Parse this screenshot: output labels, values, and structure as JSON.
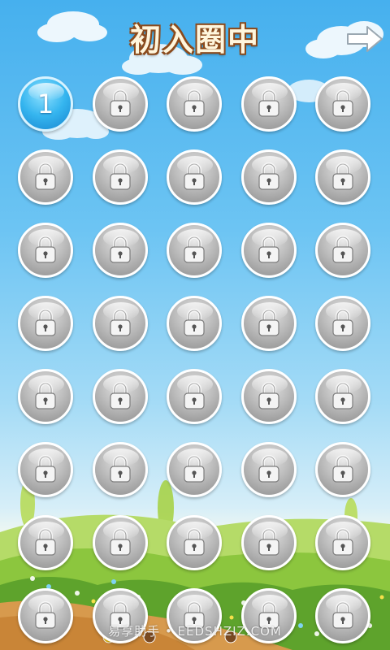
{
  "header": {
    "title": "初入圈中",
    "next_icon": "arrow-right-icon"
  },
  "levels": [
    {
      "label": "1",
      "locked": false
    },
    {
      "locked": true
    },
    {
      "locked": true
    },
    {
      "locked": true
    },
    {
      "locked": true
    },
    {
      "locked": true
    },
    {
      "locked": true
    },
    {
      "locked": true
    },
    {
      "locked": true
    },
    {
      "locked": true
    },
    {
      "locked": true
    },
    {
      "locked": true
    },
    {
      "locked": true
    },
    {
      "locked": true
    },
    {
      "locked": true
    },
    {
      "locked": true
    },
    {
      "locked": true
    },
    {
      "locked": true
    },
    {
      "locked": true
    },
    {
      "locked": true
    },
    {
      "locked": true
    },
    {
      "locked": true
    },
    {
      "locked": true
    },
    {
      "locked": true
    },
    {
      "locked": true
    },
    {
      "locked": true
    },
    {
      "locked": true
    },
    {
      "locked": true
    },
    {
      "locked": true
    },
    {
      "locked": true
    },
    {
      "locked": true
    },
    {
      "locked": true
    },
    {
      "locked": true
    },
    {
      "locked": true
    },
    {
      "locked": true
    },
    {
      "locked": true
    },
    {
      "locked": true
    },
    {
      "locked": true
    },
    {
      "locked": true
    },
    {
      "locked": true
    }
  ],
  "lock_icon": "lock-icon",
  "watermark": "易享助手 • EEDSHZIZ.COM",
  "page_indicator": {
    "count": 4,
    "active": 0
  },
  "colors": {
    "sky_top": "#46b0ee",
    "title_outline": "#8a4a1c",
    "locked_button": "#bdbdbd",
    "unlocked_button": "#35b5ef",
    "indicator_active": "#f5c518"
  }
}
